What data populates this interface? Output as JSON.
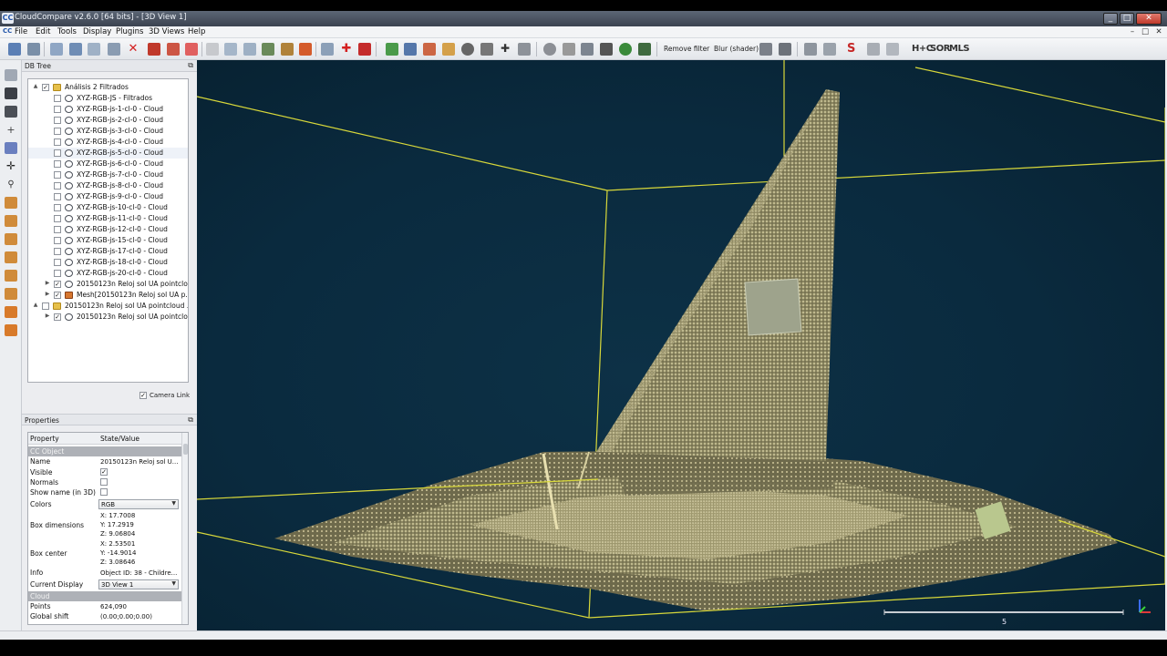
{
  "window": {
    "title": "CloudCompare v2.6.0 [64 bits] - [3D View 1]",
    "logo": "CC"
  },
  "menu": [
    "File",
    "Edit",
    "Tools",
    "Display",
    "Plugins",
    "3D Views",
    "Help"
  ],
  "toolbar": {
    "remove_filter": "Remove filter",
    "blur_shader": "Blur (shader)",
    "hnc": "H+C",
    "sor": "SOR",
    "mls": "MLS"
  },
  "db_tree": {
    "title": "DB Tree",
    "items": [
      {
        "label": "Análisis 2 Filtrados",
        "checked": "✓",
        "exp": "▲",
        "type": "folder"
      },
      {
        "label": "XYZ-RGB-JS - Filtrados",
        "checked": "",
        "type": "cloud"
      },
      {
        "label": "XYZ-RGB-js-1-cl-0 - Cloud",
        "checked": "",
        "type": "cloud"
      },
      {
        "label": "XYZ-RGB-js-2-cl-0 - Cloud",
        "checked": "",
        "type": "cloud"
      },
      {
        "label": "XYZ-RGB-js-3-cl-0 - Cloud",
        "checked": "",
        "type": "cloud"
      },
      {
        "label": "XYZ-RGB-js-4-cl-0 - Cloud",
        "checked": "",
        "type": "cloud"
      },
      {
        "label": "XYZ-RGB-js-5-cl-0 - Cloud",
        "checked": "",
        "type": "cloud"
      },
      {
        "label": "XYZ-RGB-js-6-cl-0 - Cloud",
        "checked": "",
        "type": "cloud"
      },
      {
        "label": "XYZ-RGB-js-7-cl-0 - Cloud",
        "checked": "",
        "type": "cloud"
      },
      {
        "label": "XYZ-RGB-js-8-cl-0 - Cloud",
        "checked": "",
        "type": "cloud"
      },
      {
        "label": "XYZ-RGB-js-9-cl-0 - Cloud",
        "checked": "",
        "type": "cloud"
      },
      {
        "label": "XYZ-RGB-js-10-cl-0 - Cloud",
        "checked": "",
        "type": "cloud"
      },
      {
        "label": "XYZ-RGB-js-11-cl-0 - Cloud",
        "checked": "",
        "type": "cloud"
      },
      {
        "label": "XYZ-RGB-js-12-cl-0 - Cloud",
        "checked": "",
        "type": "cloud"
      },
      {
        "label": "XYZ-RGB-js-15-cl-0 - Cloud",
        "checked": "",
        "type": "cloud"
      },
      {
        "label": "XYZ-RGB-js-17-cl-0 - Cloud",
        "checked": "",
        "type": "cloud"
      },
      {
        "label": "XYZ-RGB-js-18-cl-0 - Cloud",
        "checked": "",
        "type": "cloud"
      },
      {
        "label": "XYZ-RGB-js-20-cl-0 - Cloud",
        "checked": "",
        "type": "cloud"
      },
      {
        "label": "20150123n Reloj sol UA pointclo...",
        "checked": "✓",
        "exp": "▶",
        "type": "cloud"
      },
      {
        "label": "Mesh[20150123n Reloj sol UA p...",
        "checked": "✓",
        "exp": "▶",
        "type": "mesh"
      },
      {
        "label": "20150123n Reloj sol UA pointcloud ...",
        "checked": "",
        "exp": "▲",
        "type": "folder"
      },
      {
        "label": "20150123n Reloj sol UA pointclo...",
        "checked": "✓",
        "exp": "▶",
        "type": "cloud"
      }
    ],
    "camera_link": "Camera Link",
    "camera_link_checked": "✓"
  },
  "properties": {
    "title": "Properties",
    "col_property": "Property",
    "col_value": "State/Value",
    "section_object": "CC Object",
    "name_key": "Name",
    "name_val": "20150123n Reloj sol U...",
    "visible_key": "Visible",
    "visible_val": "✓",
    "normals_key": "Normals",
    "normals_val": "",
    "showname_key": "Show name (in 3D)",
    "showname_val": "",
    "colors_key": "Colors",
    "colors_val": "RGB",
    "boxdim_key": "Box dimensions",
    "boxdim_x": "X: 17.7008",
    "boxdim_y": "Y: 17.2919",
    "boxdim_z": "Z: 9.06804",
    "boxcenter_key": "Box center",
    "boxcenter_x": "X: 2.53501",
    "boxcenter_y": "Y: -14.9014",
    "boxcenter_z": "Z: 3.08646",
    "info_key": "Info",
    "info_val": "Object ID: 38 - Childre...",
    "display_key": "Current Display",
    "display_val": "3D View 1",
    "section_cloud": "Cloud",
    "points_key": "Points",
    "points_val": "624,090",
    "shift_key": "Global shift",
    "shift_val": "(0.00;0.00;0.00)"
  },
  "view3d": {
    "scale_label": "5",
    "background": "#0a2a3e",
    "bbox_color": "#d8d83a"
  }
}
